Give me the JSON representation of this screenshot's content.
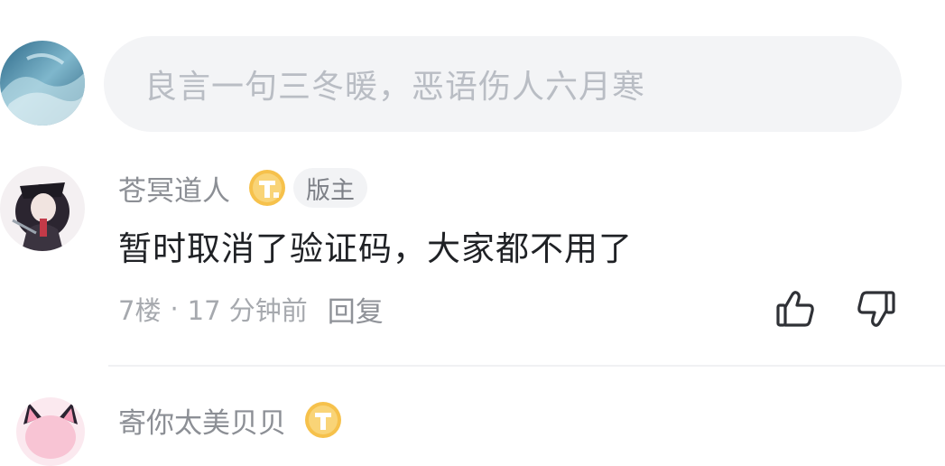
{
  "composer": {
    "placeholder": "良言一句三冬暖，恶语伤人六月寒",
    "avatar_icon": "user-avatar-wave"
  },
  "comment": {
    "username": "苍冥道人",
    "level_icon": "level-t-badge-icon",
    "role_badge": "版主",
    "text": "暂时取消了验证码，大家都不用了",
    "floor": "7楼",
    "separator": "·",
    "time": "17 分钟前",
    "reply_label": "回复",
    "like_icon": "thumbs-up-icon",
    "dislike_icon": "thumbs-down-icon"
  },
  "next_comment": {
    "username": "寄你太美贝贝",
    "level_icon": "level-t-badge-icon"
  },
  "colors": {
    "input_bg": "#f3f4f6",
    "placeholder": "#b9bdc4",
    "username": "#8c8f95",
    "badge_gold": "#f2b83a",
    "text": "#1f2125"
  }
}
